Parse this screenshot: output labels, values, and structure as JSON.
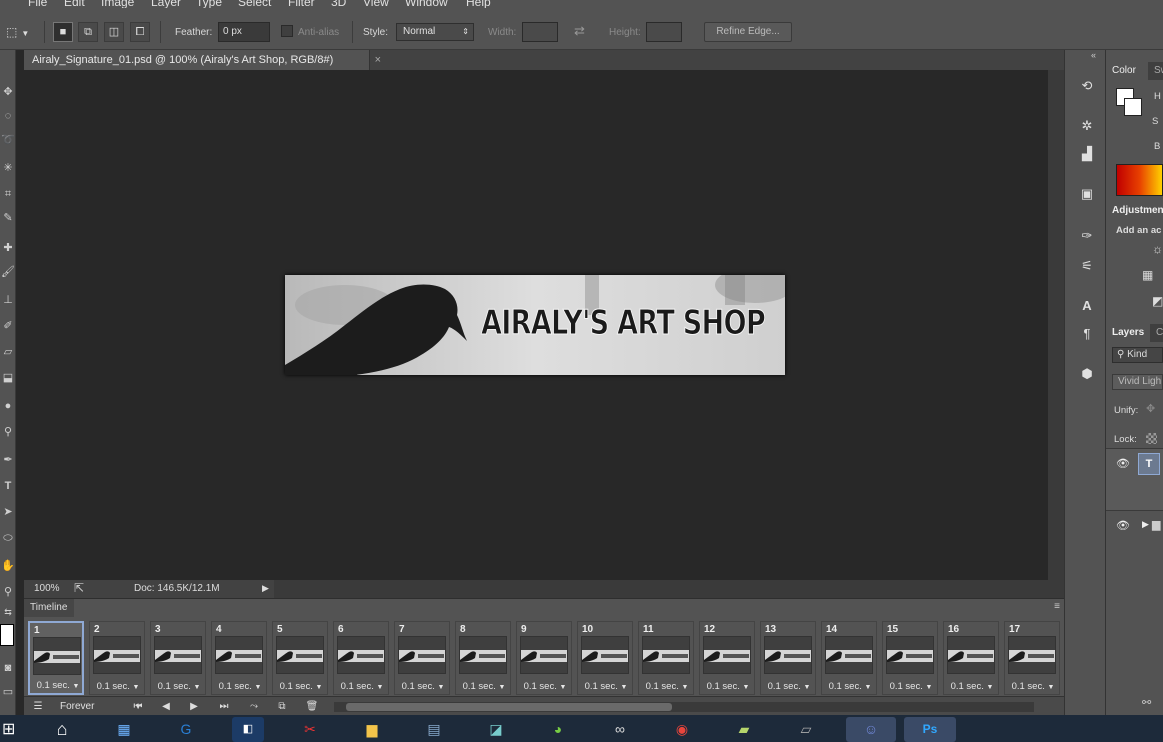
{
  "menu": [
    "File",
    "Edit",
    "Image",
    "Layer",
    "Type",
    "Select",
    "Filter",
    "3D",
    "View",
    "Window",
    "Help"
  ],
  "options": {
    "feather_label": "Feather:",
    "feather_value": "0 px",
    "antialias_label": "Anti-alias",
    "style_label": "Style:",
    "style_value": "Normal",
    "width_label": "Width:",
    "height_label": "Height:",
    "refine_label": "Refine Edge..."
  },
  "document": {
    "tab_title": "Airaly_Signature_01.psd @ 100% (Airaly's Art Shop, RGB/8#)",
    "close_glyph": "×",
    "banner_text": "AIRALY'S ART SHOP"
  },
  "status": {
    "zoom": "100%",
    "doc_info": "Doc: 146.5K/12.1M"
  },
  "timeline": {
    "title": "Timeline",
    "loop": "Forever",
    "frames": [
      {
        "n": "1",
        "delay": "0.1 sec."
      },
      {
        "n": "2",
        "delay": "0.1 sec."
      },
      {
        "n": "3",
        "delay": "0.1 sec."
      },
      {
        "n": "4",
        "delay": "0.1 sec."
      },
      {
        "n": "5",
        "delay": "0.1 sec."
      },
      {
        "n": "6",
        "delay": "0.1 sec."
      },
      {
        "n": "7",
        "delay": "0.1 sec."
      },
      {
        "n": "8",
        "delay": "0.1 sec."
      },
      {
        "n": "9",
        "delay": "0.1 sec."
      },
      {
        "n": "10",
        "delay": "0.1 sec."
      },
      {
        "n": "11",
        "delay": "0.1 sec."
      },
      {
        "n": "12",
        "delay": "0.1 sec."
      },
      {
        "n": "13",
        "delay": "0.1 sec."
      },
      {
        "n": "14",
        "delay": "0.1 sec."
      },
      {
        "n": "15",
        "delay": "0.1 sec."
      },
      {
        "n": "16",
        "delay": "0.1 sec."
      },
      {
        "n": "17",
        "delay": "0.1 sec."
      }
    ]
  },
  "panels": {
    "color_tab": "Color",
    "swatches_tab": "Sw",
    "h": "H",
    "s": "S",
    "b": "B",
    "adjustments_tab": "Adjustmen",
    "add_adjustment": "Add an ac",
    "layers_tab": "Layers",
    "channels_tab": "C",
    "kind": "Kind",
    "blend_mode": "Vivid Ligh",
    "unify": "Unify:",
    "lock": "Lock:",
    "text_layer_glyph": "T"
  },
  "taskbar": [
    "start",
    "explorer",
    "browser-g",
    "dolby",
    "paint",
    "folder",
    "calculator",
    "notes",
    "color-app",
    "infinity",
    "chrome",
    "folder2",
    "wacom",
    "discord",
    "photoshop"
  ],
  "colors": {
    "accent": "#8fa9d4",
    "ui_dark": "#282828",
    "ui_mid": "#535353",
    "taskbar": "#1d2a3a"
  }
}
